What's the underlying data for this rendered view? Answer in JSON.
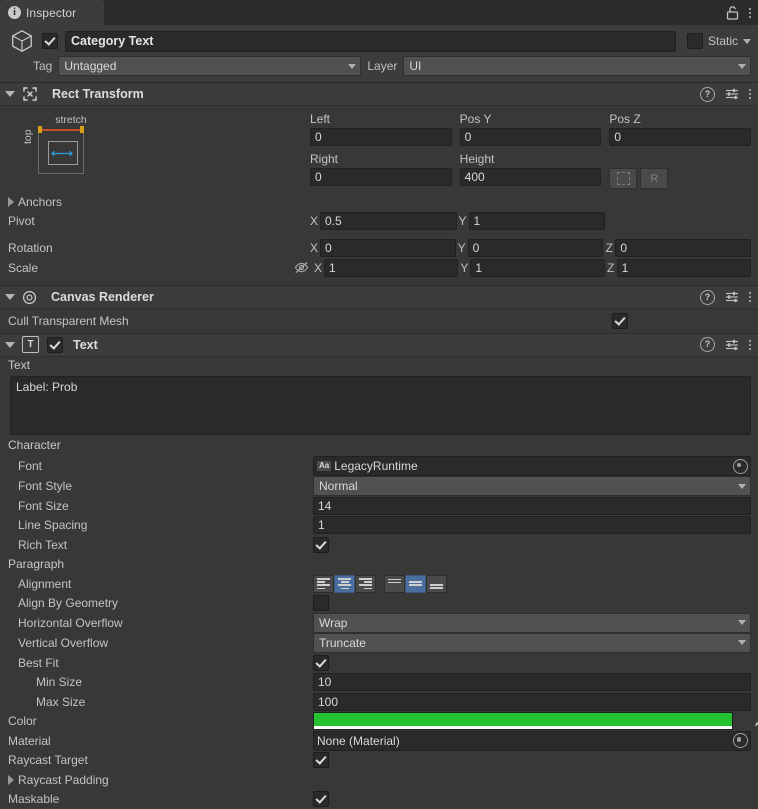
{
  "window": {
    "tab_label": "Inspector",
    "tab_icon": "info-icon",
    "lock_icon": "unlocked-padlock-icon",
    "menu_icon": "kebab-menu-icon"
  },
  "object_header": {
    "enabled": true,
    "name": "Category Text",
    "static_label": "Static",
    "static_checked": false,
    "tag_label": "Tag",
    "tag_value": "Untagged",
    "layer_label": "Layer",
    "layer_value": "UI"
  },
  "rect_transform": {
    "title": "Rect Transform",
    "expanded": true,
    "anchor_preset": {
      "caption_top": "stretch",
      "caption_left": "top"
    },
    "columns": [
      {
        "label": "Left",
        "value": "0"
      },
      {
        "label": "Pos Y",
        "value": "0"
      },
      {
        "label": "Pos Z",
        "value": "0"
      }
    ],
    "columns2": [
      {
        "label": "Right",
        "value": "0"
      },
      {
        "label": "Height",
        "value": "400"
      }
    ],
    "blueprint_button": "blueprint-mode",
    "raw_button": "R",
    "anchors_label": "Anchors",
    "pivot": {
      "label": "Pivot",
      "x_axis": "X",
      "x": "0.5",
      "y_axis": "Y",
      "y": "1"
    },
    "rotation": {
      "label": "Rotation",
      "x_axis": "X",
      "x": "0",
      "y_axis": "Y",
      "y": "0",
      "z_axis": "Z",
      "z": "0"
    },
    "scale": {
      "label": "Scale",
      "x_axis": "X",
      "x": "1",
      "y_axis": "Y",
      "y": "1",
      "z_axis": "Z",
      "z": "1"
    }
  },
  "canvas_renderer": {
    "title": "Canvas Renderer",
    "cull_label": "Cull Transparent Mesh",
    "cull_checked": true
  },
  "text_component": {
    "title": "Text",
    "enabled": true,
    "text_label": "Text",
    "text_value": "Label: Prob",
    "character_label": "Character",
    "font_label": "Font",
    "font_value": "LegacyRuntime",
    "font_badge": "Aa",
    "font_style_label": "Font Style",
    "font_style_value": "Normal",
    "font_size_label": "Font Size",
    "font_size_value": "14",
    "line_spacing_label": "Line Spacing",
    "line_spacing_value": "1",
    "rich_text_label": "Rich Text",
    "rich_text_checked": true,
    "paragraph_label": "Paragraph",
    "alignment_label": "Alignment",
    "alignment_horizontal": "center",
    "alignment_vertical": "middle",
    "align_by_geometry_label": "Align By Geometry",
    "align_by_geometry_checked": false,
    "horizontal_overflow_label": "Horizontal Overflow",
    "horizontal_overflow_value": "Wrap",
    "vertical_overflow_label": "Vertical Overflow",
    "vertical_overflow_value": "Truncate",
    "best_fit_label": "Best Fit",
    "best_fit_checked": true,
    "min_size_label": "Min Size",
    "min_size_value": "10",
    "max_size_label": "Max Size",
    "max_size_value": "100",
    "color_label": "Color",
    "color_value": "#22c32e",
    "color_alpha": "#ffffff",
    "material_label": "Material",
    "material_value": "None (Material)",
    "raycast_target_label": "Raycast Target",
    "raycast_target_checked": true,
    "raycast_padding_label": "Raycast Padding",
    "maskable_label": "Maskable",
    "maskable_checked": true
  }
}
